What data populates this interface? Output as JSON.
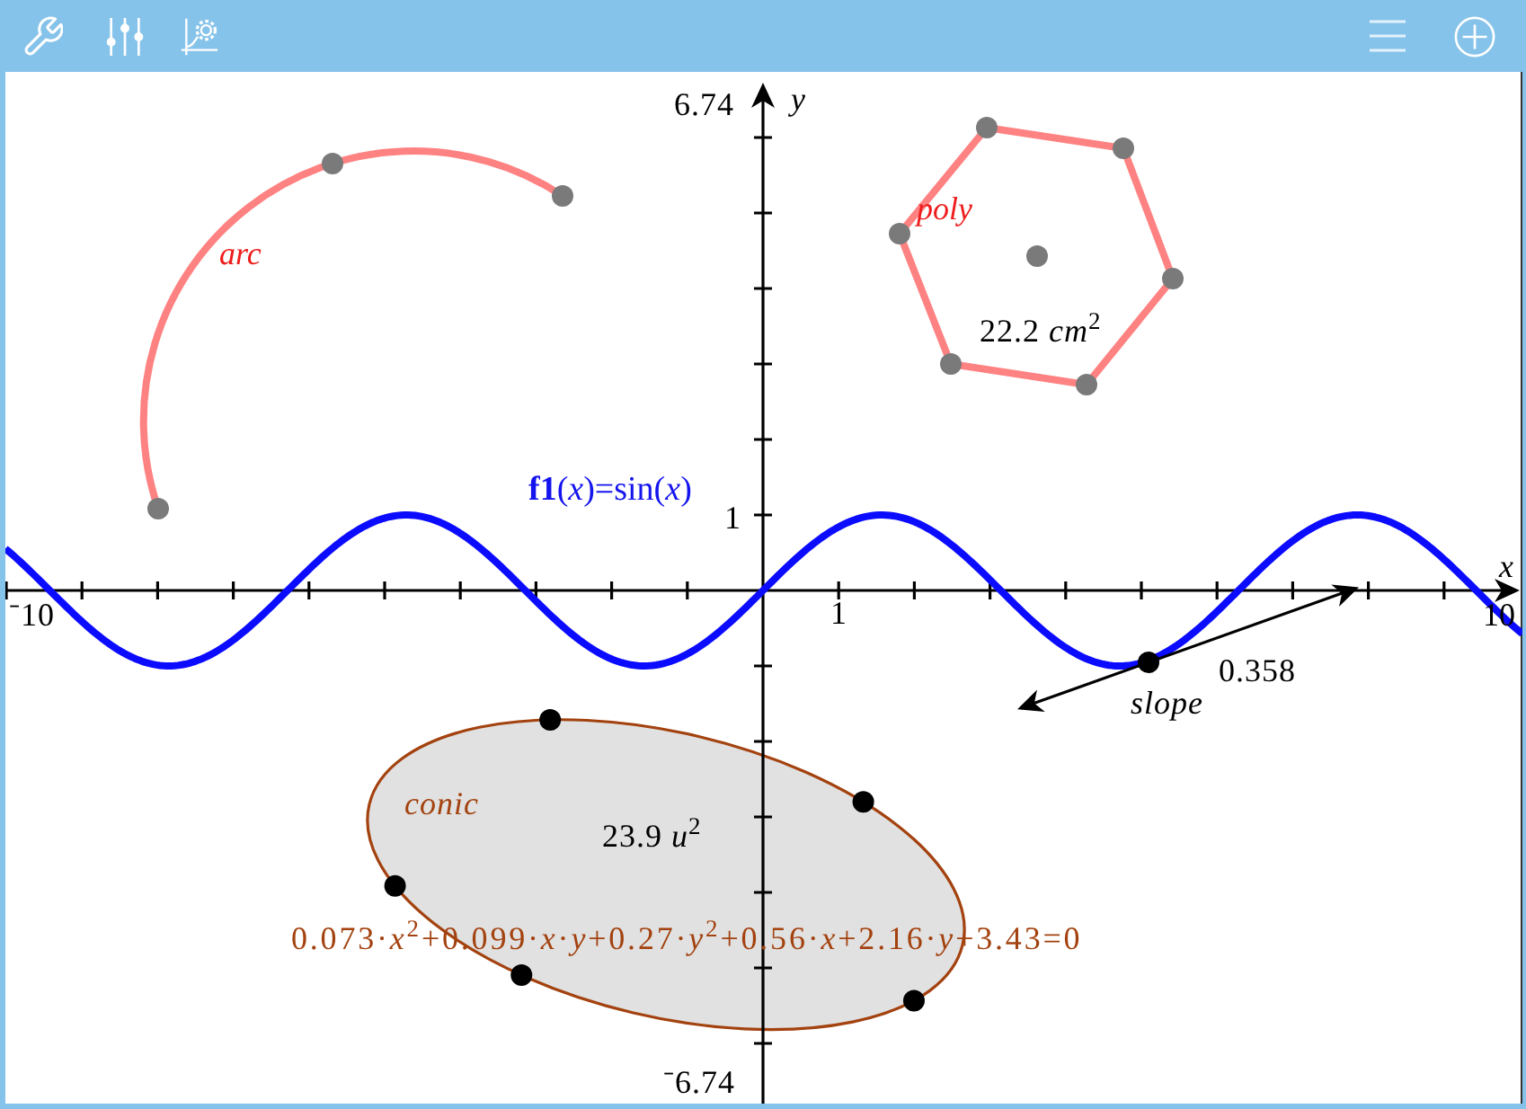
{
  "graph": {
    "axes": {
      "y_max_label": "6.74",
      "y_label": "y",
      "y_unit_label": "1",
      "x_min_label": "⁻10",
      "x_unit_label": "1",
      "x_max_label": "10",
      "x_label": "x",
      "y_min_label": "⁻6.74"
    },
    "arc": {
      "label": "arc"
    },
    "polygon": {
      "label": "poly",
      "area": "22.2 *cm*$^{2}$"
    },
    "function": {
      "label": "**f1**(*x*)=sin(*x*)"
    },
    "tangent": {
      "value": "0.358",
      "label": "slope"
    },
    "conic": {
      "label": "conic",
      "area": "23.9 *u*$^{2}$",
      "equation": "0.073·*x*$^{2}$+0.099·*x*·*y*+0.27·*y*$^{2}$+0.56·*x*+2.16·*y*+3.43=0"
    }
  }
}
